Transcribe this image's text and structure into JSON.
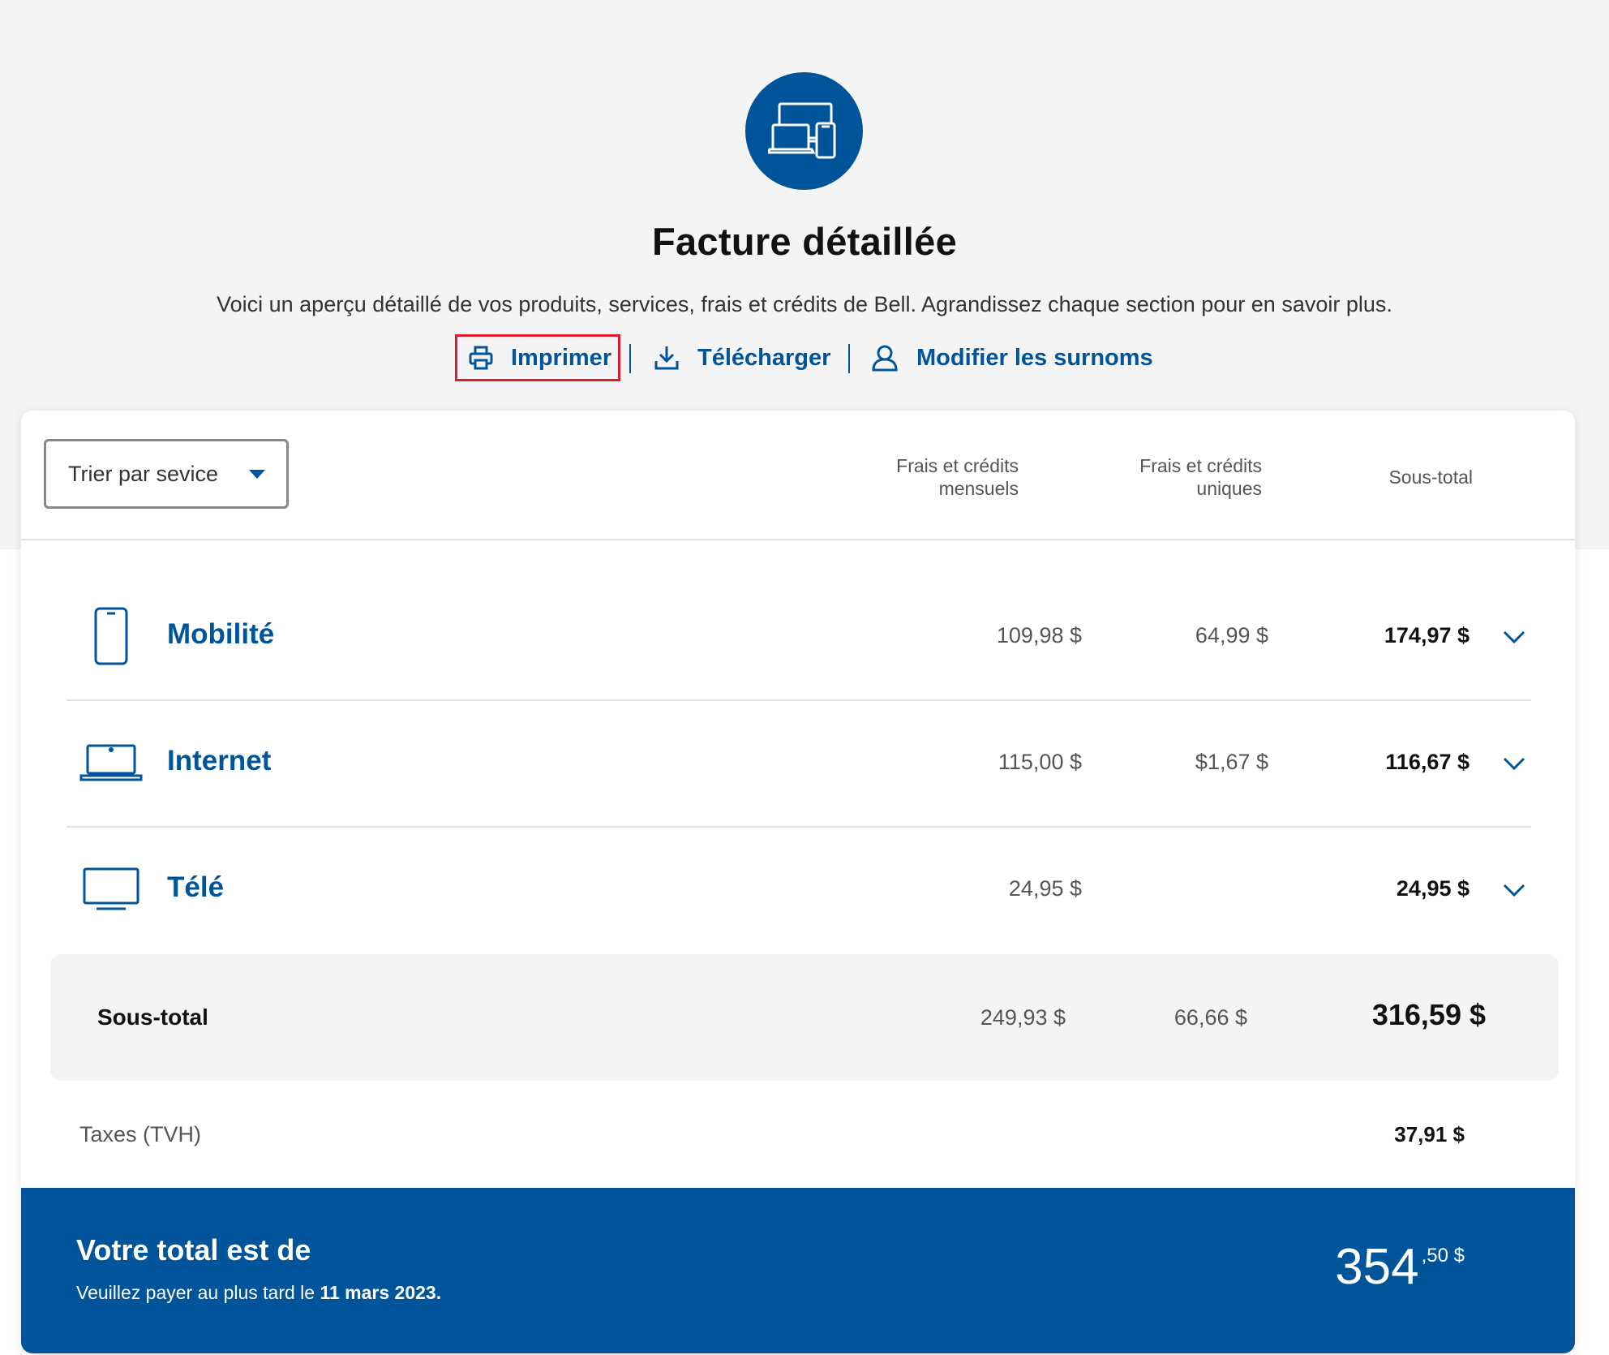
{
  "header": {
    "title": "Facture détaillée",
    "subtitle": "Voici un aperçu détaillé de vos produits, services, frais et crédits de Bell. Agrandissez chaque section pour en savoir plus.",
    "hero_icon": "devices-icon"
  },
  "actions": {
    "print_label": "Imprimer",
    "download_label": "Télécharger",
    "nicknames_label": "Modifier les surnoms"
  },
  "table": {
    "sort_label": "Trier par sevice",
    "col_monthly_1": "Frais et crédits",
    "col_monthly_2": "mensuels",
    "col_onetime_1": "Frais et crédits",
    "col_onetime_2": "uniques",
    "col_subtotal": "Sous-total"
  },
  "services": [
    {
      "name": "Mobilité",
      "icon": "smartphone-icon",
      "monthly": "109,98 $",
      "onetime": "64,99 $",
      "subtotal": "174,97 $"
    },
    {
      "name": "Internet",
      "icon": "laptop-icon",
      "monthly": "115,00 $",
      "onetime": "$1,67 $",
      "subtotal": "116,67 $"
    },
    {
      "name": "Télé",
      "icon": "tv-icon",
      "monthly": "24,95 $",
      "onetime": "",
      "subtotal": "24,95 $"
    }
  ],
  "subtotal": {
    "label": "Sous-total",
    "monthly": "249,93 $",
    "onetime": "66,66 $",
    "total": "316,59 $"
  },
  "taxes": {
    "label": "Taxes (TVH)",
    "amount": "37,91 $"
  },
  "total": {
    "title": "Votre total est de",
    "note_prefix": "Veuillez payer au plus tard le",
    "due_date": "11 mars 2023.",
    "amount_int": "354",
    "amount_cents": ",50 $"
  },
  "colors": {
    "brand_blue": "#00549a",
    "highlight_red": "#e01c2c",
    "background_gray": "#f4f4f4"
  }
}
